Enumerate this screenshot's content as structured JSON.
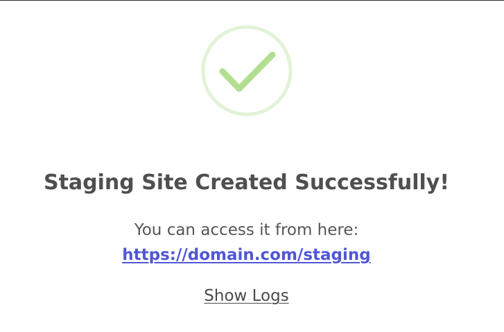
{
  "success": {
    "icon": "checkmark-circle-icon",
    "title": "Staging Site Created Successfully!",
    "message": "You can access it from here:",
    "link_text": "https://domain.com/staging",
    "logs_label": "Show Logs"
  },
  "colors": {
    "circle": "#e2f2d7",
    "checkmark": "#b3de91",
    "title": "#4f4f4f",
    "text": "#555555",
    "link": "#5057d6"
  }
}
